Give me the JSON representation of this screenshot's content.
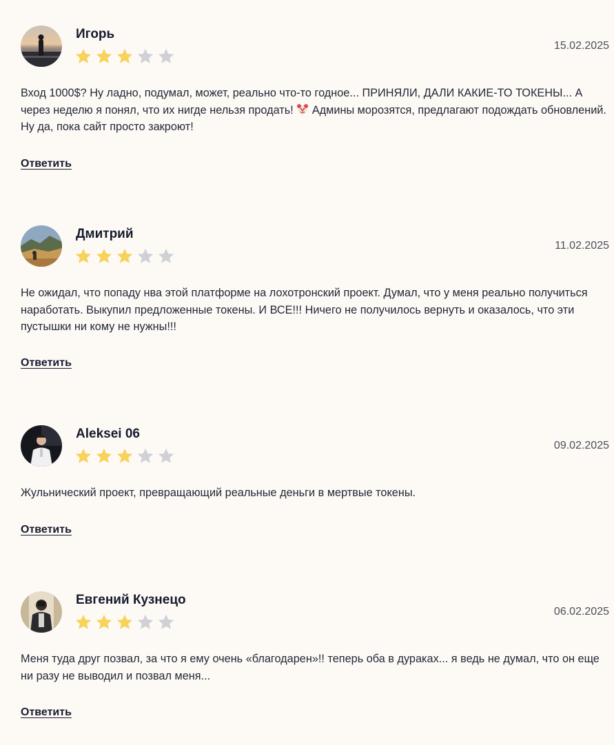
{
  "reviews": [
    {
      "author": "Игорь",
      "date": "15.02.2025",
      "rating": 3,
      "rating_max": 5,
      "text_before_emoji": "Вход 1000$? Ну ладно, подумал, может, реально что-то годное... ПРИНЯЛИ, ДАЛИ КАКИЕ-ТО ТОКЕНЫ... А через неделю я понял, что их нигде нельзя продать! ",
      "emoji": "clown-face-icon",
      "text_after_emoji": " Админы морозятся, предлагают подождать обновлений. Ну да, пока сайт просто закроют!",
      "reply_label": "Ответить"
    },
    {
      "author": "Дмитрий",
      "date": "11.02.2025",
      "rating": 3,
      "rating_max": 5,
      "text": "Не ожидал, что попаду нва этой платформе на лохотронский проект. Думал, что у меня реально получиться наработать. Выкупил предложенные токены. И ВСЕ!!! Ничего не получилось вернуть и оказалось, что эти пустышки ни кому не нужны!!!",
      "reply_label": "Ответить"
    },
    {
      "author": "Aleksei 06",
      "date": "09.02.2025",
      "rating": 3,
      "rating_max": 5,
      "text": "Жульнический проект, превращающий реальные деньги в мертвые токены.",
      "reply_label": "Ответить"
    },
    {
      "author": "Евгений Кузнецо",
      "date": "06.02.2025",
      "rating": 3,
      "rating_max": 5,
      "text": "Меня туда друг позвал, за что я ему очень «благодарен»!! теперь оба в дураках... я ведь не думал, что он еще ни разу не выводил и позвал меня...",
      "reply_label": "Ответить"
    }
  ],
  "colors": {
    "star_filled": "#f7d35c",
    "star_empty": "#cfd1d6",
    "background": "#fdfaf6",
    "text": "#242735"
  }
}
